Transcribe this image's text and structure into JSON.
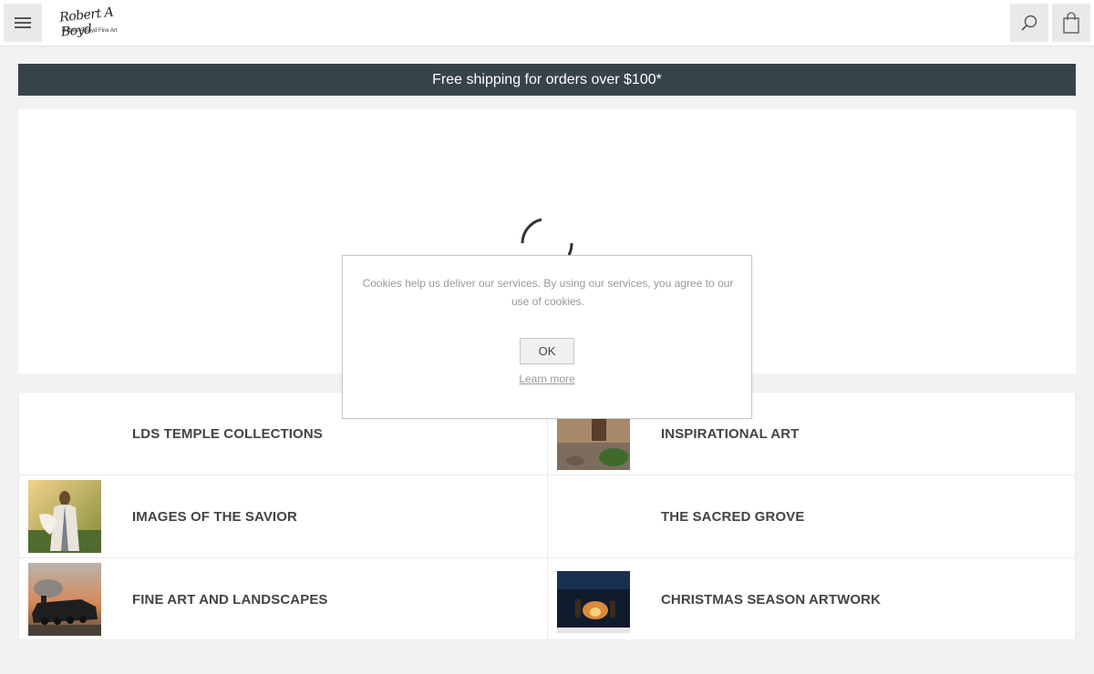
{
  "header": {
    "logo_signature": "Robert A Boyd",
    "logo_subtitle": "Robert A Boyd Fine Art"
  },
  "banner": {
    "text": "Free shipping for orders over $100*"
  },
  "categories": [
    {
      "label": "LDS TEMPLE COLLECTIONS"
    },
    {
      "label": "INSPIRATIONAL ART"
    },
    {
      "label": "IMAGES OF THE SAVIOR"
    },
    {
      "label": "THE SACRED GROVE"
    },
    {
      "label": "FINE ART AND LANDSCAPES"
    },
    {
      "label": "CHRISTMAS SEASON ARTWORK"
    }
  ],
  "cookie_dialog": {
    "message": "Cookies help us deliver our services. By using our services, you agree to our use of cookies.",
    "ok_label": "OK",
    "learn_more_label": "Learn more"
  },
  "icons": {
    "menu": "hamburger-icon",
    "search": "search-icon",
    "cart": "shopping-bag-icon",
    "loading": "spinner-icon"
  },
  "colors": {
    "banner_bg": "#37434b",
    "page_bg": "#f2f2f2"
  }
}
